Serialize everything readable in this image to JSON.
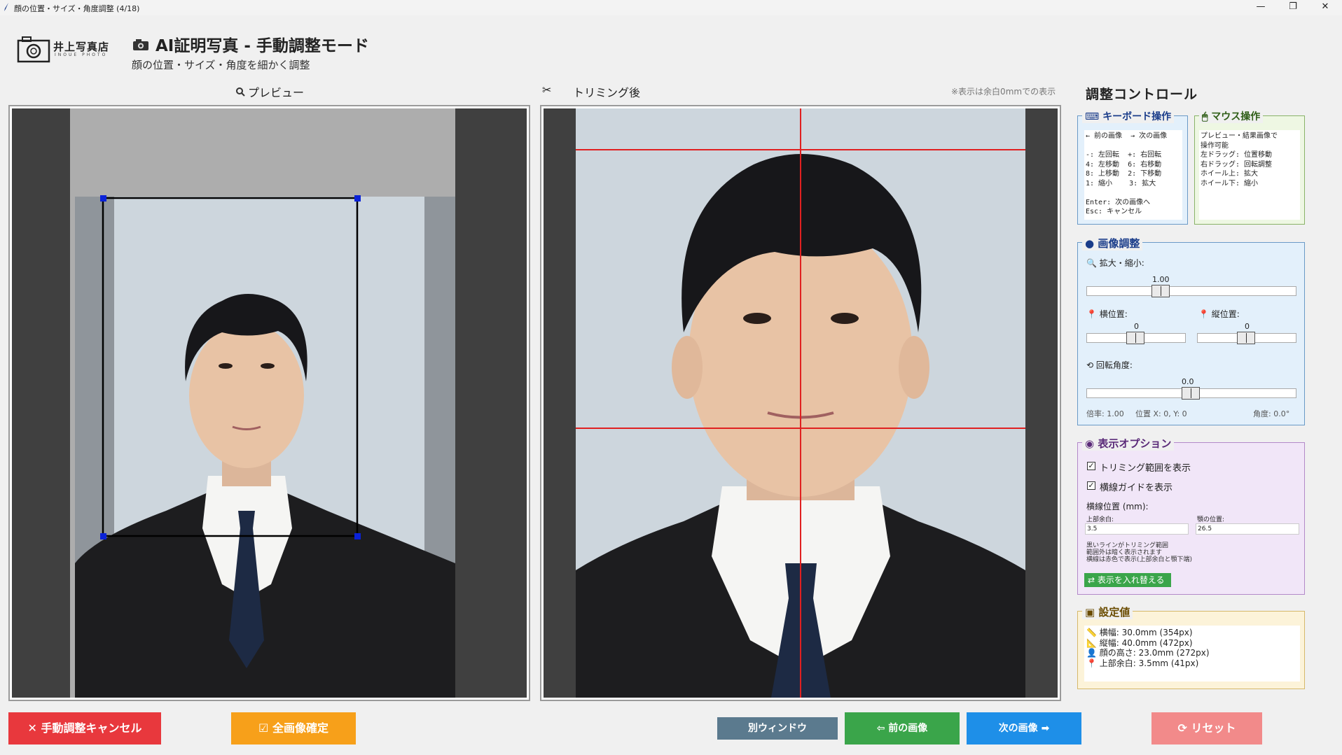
{
  "window": {
    "title": "顔の位置・サイズ・角度調整 (4/18)",
    "minimize": "—",
    "maximize": "❐",
    "close": "✕"
  },
  "logo": {
    "name": "井上写真店",
    "sub": "INOUE PHOTO"
  },
  "header": {
    "title": "AI証明写真 - 手動調整モード",
    "subtitle": "顔の位置・サイズ・角度を細かく調整"
  },
  "preview": {
    "label": "プレビュー",
    "icon": "magnifier-icon"
  },
  "trim": {
    "label": "トリミング後",
    "icon": "scissors-icon",
    "note": "※表示は余白0mmでの表示"
  },
  "controls": {
    "title": "調整コントロール"
  },
  "keyboard": {
    "title": "キーボード操作",
    "lines": [
      "← 前の画像  → 次の画像",
      "",
      "-: 左回転  +: 右回転",
      "4: 左移動  6: 右移動",
      "8: 上移動  2: 下移動",
      "1: 縮小    3: 拡大",
      "",
      "Enter: 次の画像へ",
      "Esc: キャンセル"
    ]
  },
  "mouse": {
    "title": "マウス操作",
    "lines": [
      "プレビュー・結果画像で",
      "操作可能",
      "左ドラッグ: 位置移動",
      "右ドラッグ: 回転調整",
      "ホイール上: 拡大",
      "ホイール下: 縮小"
    ]
  },
  "image_adjust": {
    "title": "画像調整",
    "zoom_label": "拡大・縮小:",
    "zoom_value": "1.00",
    "zoom_level": 1.0,
    "x_label": "横位置:",
    "x_value": "0",
    "y_label": "縦位置:",
    "y_value": "0",
    "rot_label": "回転角度:",
    "rot_value": "0.0",
    "status_scale": "倍率: 1.00",
    "status_pos": "位置 X: 0, Y: 0",
    "status_angle": "角度: 0.0°"
  },
  "display": {
    "title": "表示オプション",
    "show_trim": "トリミング範囲を表示",
    "show_guides": "横線ガイドを表示",
    "guide_pos_label": "横線位置 (mm):",
    "top_margin_label": "上部余白:",
    "top_margin_value": "3.5",
    "chin_label": "顎の位置:",
    "chin_value": "26.5",
    "note1": "黒いラインがトリミング範囲",
    "note2": "範囲外は暗く表示されます",
    "note3": "横線は赤色で表示(上部余白と顎下端)",
    "swap_button": "表示を入れ替える"
  },
  "settings": {
    "title": "設定値",
    "width": "横幅: 30.0mm (354px)",
    "height": "縦幅: 40.0mm (472px)",
    "face": "顔の高さ: 23.0mm (272px)",
    "top": "上部余白: 3.5mm (41px)"
  },
  "buttons": {
    "cancel": "手動調整キャンセル",
    "confirm_all": "全画像確定",
    "separate": "別ウィンドウ",
    "prev": "前の画像",
    "next": "次の画像",
    "reset": "リセット"
  },
  "colors": {
    "cancel": "#e8383d",
    "confirm": "#f7a01a",
    "separate": "#5b7a8e",
    "prev": "#3aa54a",
    "next": "#1e8fe8",
    "reset": "#f28a8a",
    "guide": "#e02020",
    "handle": "#0a22d8"
  }
}
